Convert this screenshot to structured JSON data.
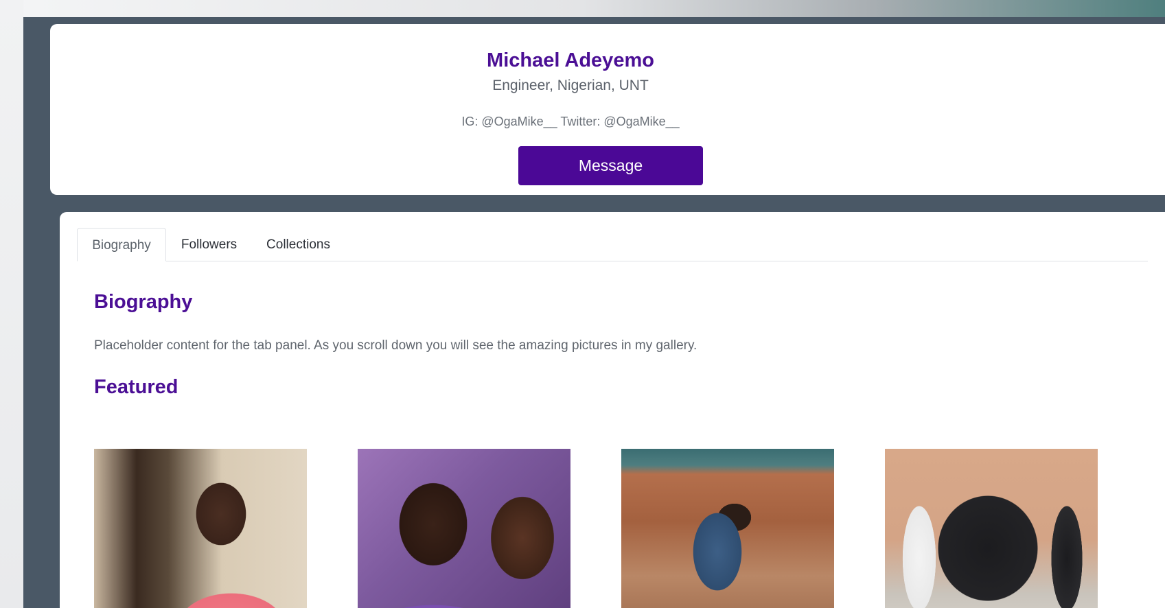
{
  "profile": {
    "name": "Michael Adeyemo",
    "tagline": "Engineer, Nigerian, UNT",
    "socials": "IG: @OgaMike__ Twitter: @OgaMike__",
    "message_label": "Message"
  },
  "tabs": [
    {
      "label": "Biography",
      "active": true
    },
    {
      "label": "Followers",
      "active": false
    },
    {
      "label": "Collections",
      "active": false
    }
  ],
  "biography": {
    "heading": "Biography",
    "text": "Placeholder content for the tab panel. As you scroll down you will see the amazing pictures in my gallery."
  },
  "featured": {
    "heading": "Featured"
  },
  "colors": {
    "accent": "#4b0f95",
    "button": "#4b0896",
    "page_background": "#4a5866"
  }
}
